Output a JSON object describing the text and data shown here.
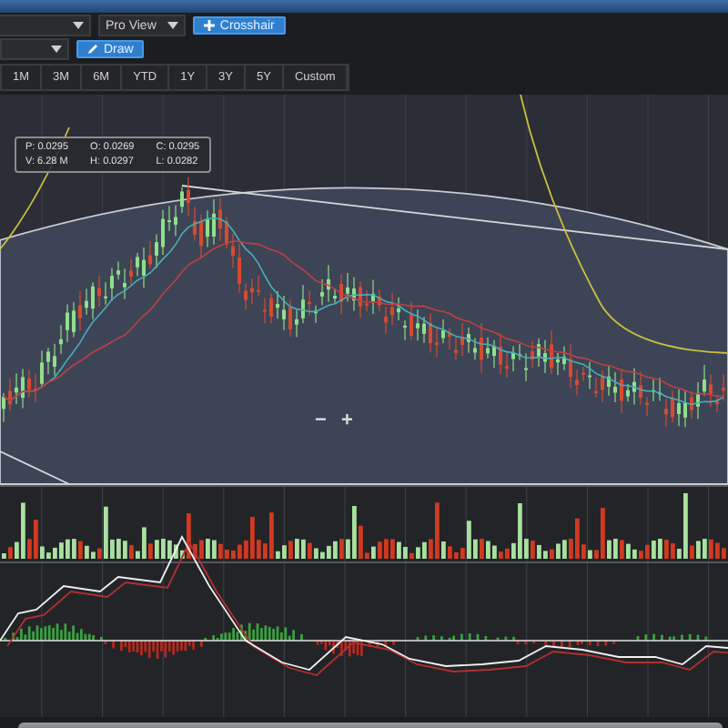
{
  "toolbar": {
    "rows": [
      {
        "items": [
          {
            "kind": "dropdown"
          },
          {
            "kind": "dropdown",
            "label": "Pro View"
          },
          {
            "kind": "tool",
            "label": "Crosshair"
          }
        ]
      },
      {
        "items": [
          {
            "kind": "dropdown"
          },
          {
            "kind": "tool",
            "label": "Draw"
          }
        ]
      }
    ]
  },
  "periods": [
    "1M",
    "3M",
    "6M",
    "YTD",
    "1Y",
    "3Y",
    "5Y",
    "Custom"
  ],
  "tooltip": {
    "fields": [
      "P: 0.0295",
      "O: 0.0269",
      "C: 0.0295",
      "V: 6.28 M",
      "H: 0.0297",
      "L: 0.0282"
    ]
  },
  "zoom_controls": [
    "−",
    "+"
  ]
}
